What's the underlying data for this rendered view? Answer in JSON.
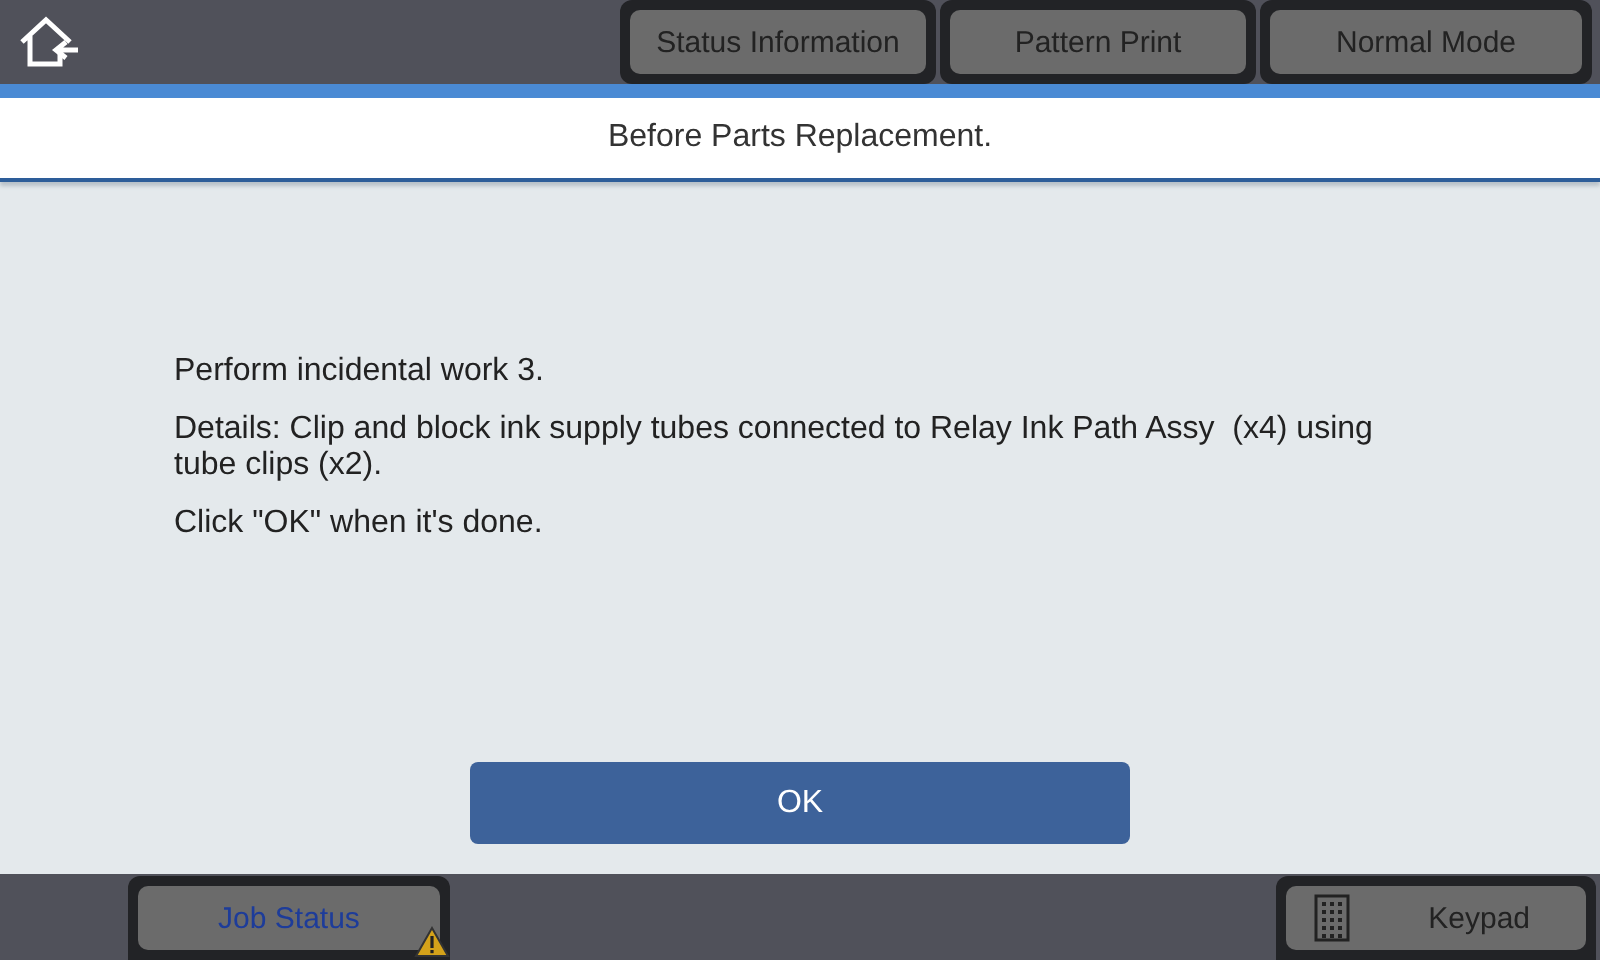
{
  "header": {
    "buttons": [
      "Status Information",
      "Pattern Print",
      "Normal Mode"
    ]
  },
  "title": "Before Parts Replacement.",
  "message": [
    "Perform incidental work 3.",
    "Details: Clip and block ink supply tubes connected to Relay Ink Path Assy  (x4) using tube clips (x2).",
    "Click \"OK\" when it's done."
  ],
  "ok_button": "OK",
  "footer": {
    "job_status": {
      "label": "Job Status",
      "warning": true
    },
    "keypad": "Keypad"
  }
}
